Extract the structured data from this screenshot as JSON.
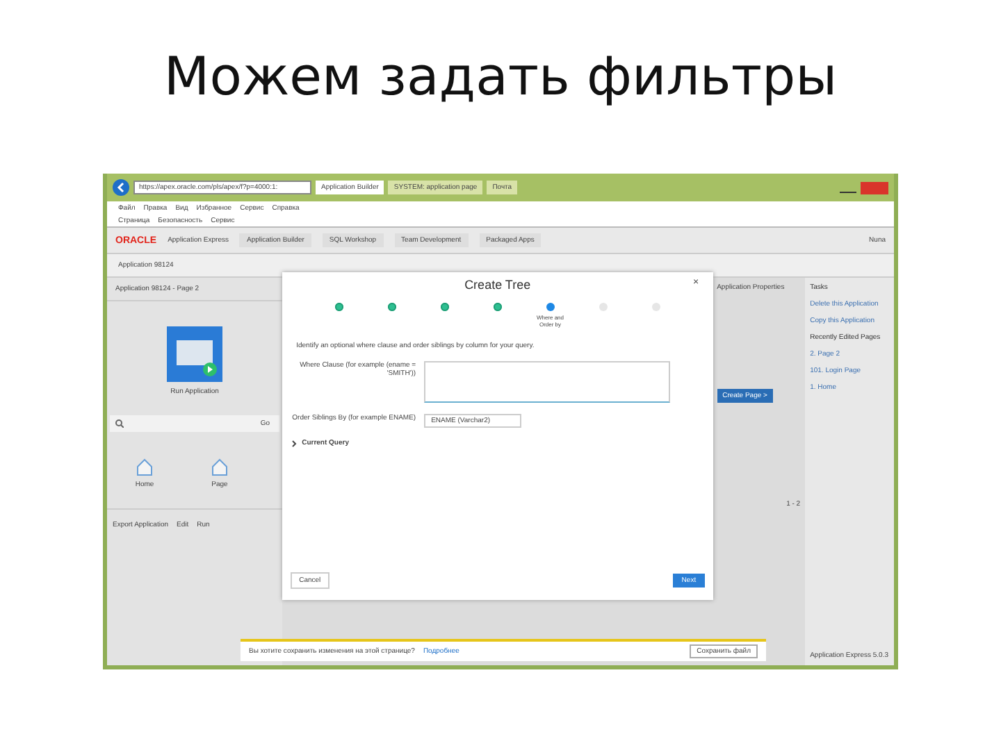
{
  "slide_title": "Можем задать фильтры",
  "browser": {
    "address": "https://apex.oracle.com/pls/apex/f?p=4000:1:",
    "tabs": [
      {
        "label": "Application Builder",
        "selected": true
      },
      {
        "label": "SYSTEM: application page",
        "selected": false
      },
      {
        "label": "Почта",
        "selected": false
      }
    ],
    "menu": [
      "Файл",
      "Правка",
      "Вид",
      "Избранное",
      "Сервис",
      "Справка"
    ],
    "toolbar": [
      "Страница",
      "Безопасность",
      "Сервис"
    ]
  },
  "apex": {
    "logo": "ORACLE",
    "product": "Application Express",
    "nav": [
      "Application Builder",
      "SQL Workshop",
      "Team Development",
      "Packaged Apps"
    ],
    "user": "Nuna",
    "breadcrumb": "Application 98124"
  },
  "left": {
    "heading": "Application 98124 - Page 2",
    "tile": "Run Application",
    "search_button": "Go",
    "icons": [
      "Home",
      "Page"
    ],
    "footer": [
      "Export Application",
      "Edit",
      "Run"
    ]
  },
  "right": {
    "tab": "Application Properties",
    "tasks_title": "Tasks",
    "tasks": [
      "Delete this Application",
      "Copy this Application"
    ],
    "recent_title": "Recently Edited Pages",
    "recent": [
      "2. Page 2",
      "101. Login Page",
      "1. Home"
    ],
    "create_button": "Create Page >",
    "pager": "1 - 2",
    "footer": "Application Express 5.0.3"
  },
  "dialog": {
    "title": "Create Tree",
    "close": "×",
    "steps": [
      {
        "completed": true,
        "selected": false
      },
      {
        "completed": true,
        "selected": false
      },
      {
        "completed": true,
        "selected": false
      },
      {
        "completed": true,
        "selected": false
      },
      {
        "completed": false,
        "selected": true,
        "label": "Where and Order by"
      },
      {
        "completed": false,
        "selected": false
      },
      {
        "completed": false,
        "selected": false
      }
    ],
    "intro": "Identify an optional where clause and order siblings by column for your query.",
    "fields": [
      {
        "kind": "textarea",
        "label": "Where Clause (for example (ename = 'SMITH'))"
      },
      {
        "kind": "select",
        "label": "Order Siblings By (for example ENAME)",
        "value": "ENAME (Varchar2)"
      }
    ],
    "section": {
      "label": "Current Query",
      "expanded": false
    },
    "cancel": "Cancel",
    "next": "Next"
  },
  "notification": {
    "text": "Вы хотите сохранить изменения на этой странице?",
    "link": "Подробнее",
    "button": "Сохранить файл"
  }
}
